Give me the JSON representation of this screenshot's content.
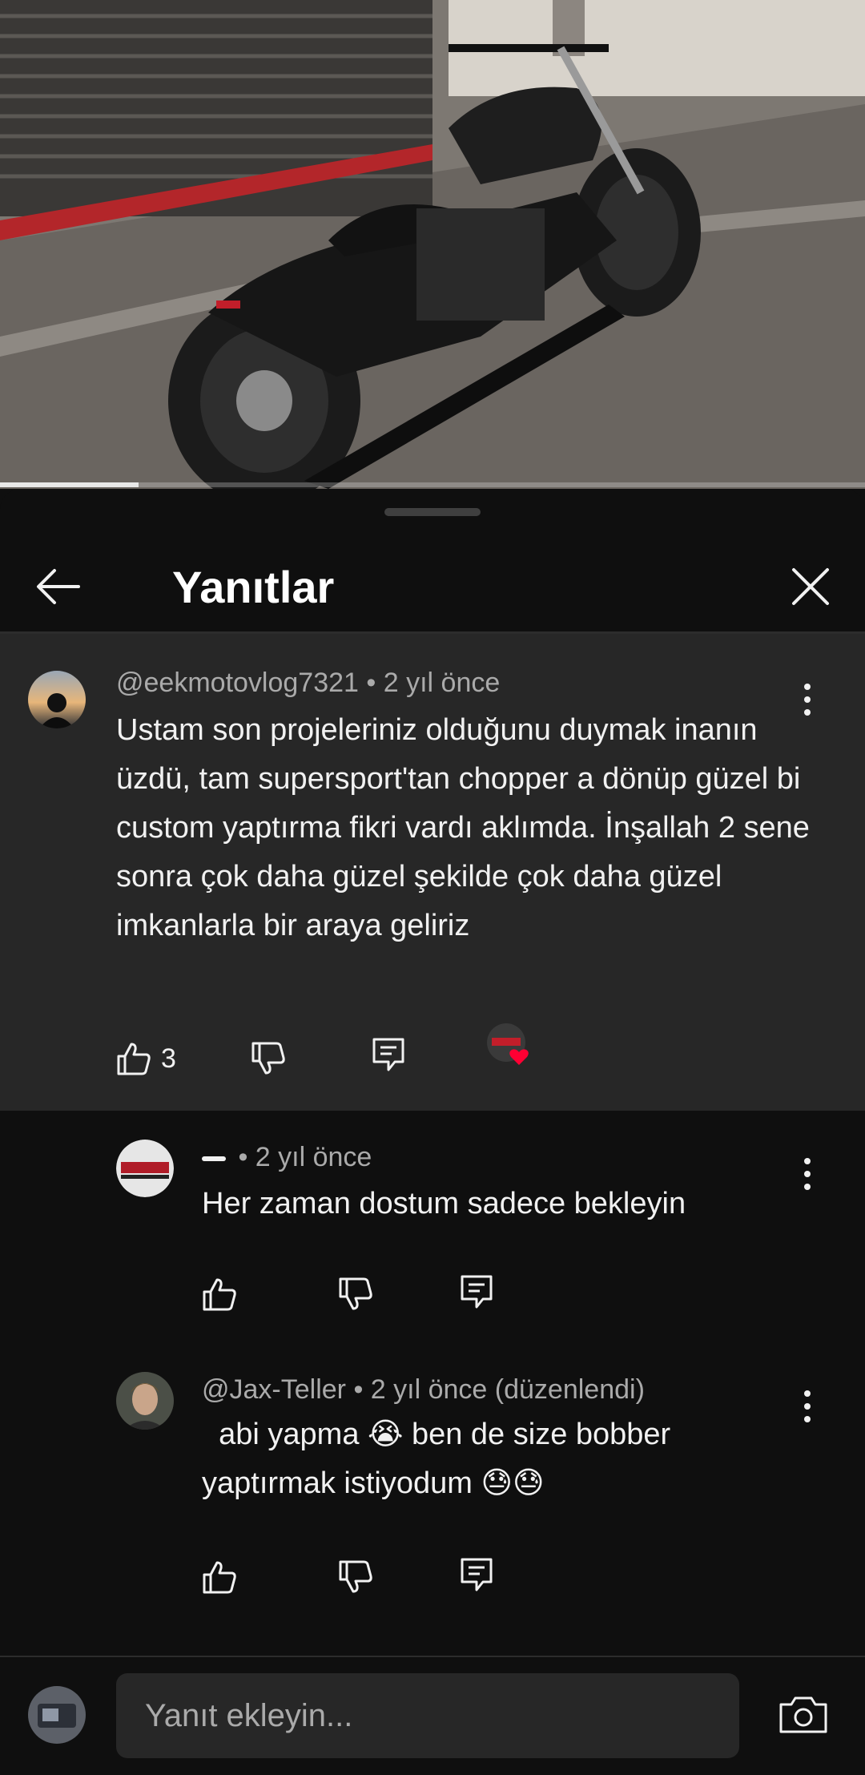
{
  "video": {
    "progress": 0.16
  },
  "sheet": {
    "title": "Yanıtlar"
  },
  "parent_comment": {
    "author": "@eekmotovlog7321",
    "time": "• 2 yıl önce",
    "text": "Ustam son projeleriniz olduğunu duymak inanın üzdü, tam supersport'tan chopper a dönüp güzel bi custom yaptırma fikri vardı aklımda. İnşallah 2 sene sonra çok daha güzel şekilde çok daha güzel imkanlarla bir araya geliriz",
    "likes": "3"
  },
  "replies": [
    {
      "author": "",
      "time": "• 2 yıl önce",
      "text": "Her zaman dostum sadece bekleyin"
    },
    {
      "author": "@Jax-Teller",
      "time": "• 2 yıl önce (düzenlendi)",
      "text": "  abi yapma 😭 ben de size bobber yaptırmak istiyodum 😓😓"
    }
  ],
  "composer": {
    "placeholder": "Yanıt ekleyin..."
  },
  "icons": {
    "back": "arrow-left-icon",
    "close": "close-icon",
    "menu": "more-vert-icon",
    "like": "thumbs-up-icon",
    "dislike": "thumbs-down-icon",
    "reply": "reply-icon",
    "heart": "creator-heart-icon",
    "camera": "camera-icon"
  },
  "colors": {
    "heart": "#ff0033",
    "surface": "#272727",
    "background": "#0f0f0f"
  }
}
